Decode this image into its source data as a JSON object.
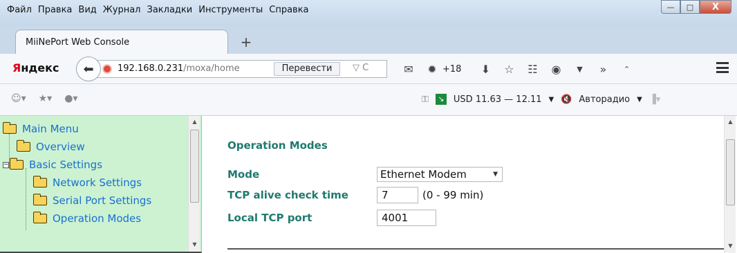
{
  "menu": {
    "items": [
      {
        "label": "Файл"
      },
      {
        "label": "Правка"
      },
      {
        "label": "Вид"
      },
      {
        "label": "Журнал"
      },
      {
        "label": "Закладки"
      },
      {
        "label": "Инструменты"
      },
      {
        "label": "Справка"
      }
    ]
  },
  "window_controls": {
    "minimize": "—",
    "maximize": "□",
    "close": "X"
  },
  "tab": {
    "title": "MiiNePort Web Console",
    "new_tab": "+"
  },
  "navbar": {
    "brand_first": "Я",
    "brand_rest": "ндекс",
    "url_host": "192.168.0.231",
    "url_path": "/moxa/home",
    "translate": "Перевести",
    "url_tail": "▽ C",
    "weather": "+18"
  },
  "toolbar": {
    "currency": "USD 11.63 — 12.11",
    "radio": "Авторадио"
  },
  "tree": {
    "items": [
      {
        "label": "Main Menu"
      },
      {
        "label": "Overview"
      },
      {
        "label": "Basic Settings"
      },
      {
        "label": "Network Settings"
      },
      {
        "label": "Serial Port Settings"
      },
      {
        "label": "Operation Modes"
      }
    ]
  },
  "main": {
    "title": "Operation Modes",
    "mode_label": "Mode",
    "mode_value": "Ethernet Modem",
    "tcp_alive_label": "TCP alive check time",
    "tcp_alive_value": "7",
    "tcp_alive_hint": "(0 - 99 min)",
    "local_port_label": "Local TCP port",
    "local_port_value": "4001"
  },
  "colors": {
    "nav_frame_bg": "#ccf2d2",
    "link": "#1a6fd0",
    "label": "#1f7a6e",
    "brand_red": "#e0001a"
  }
}
